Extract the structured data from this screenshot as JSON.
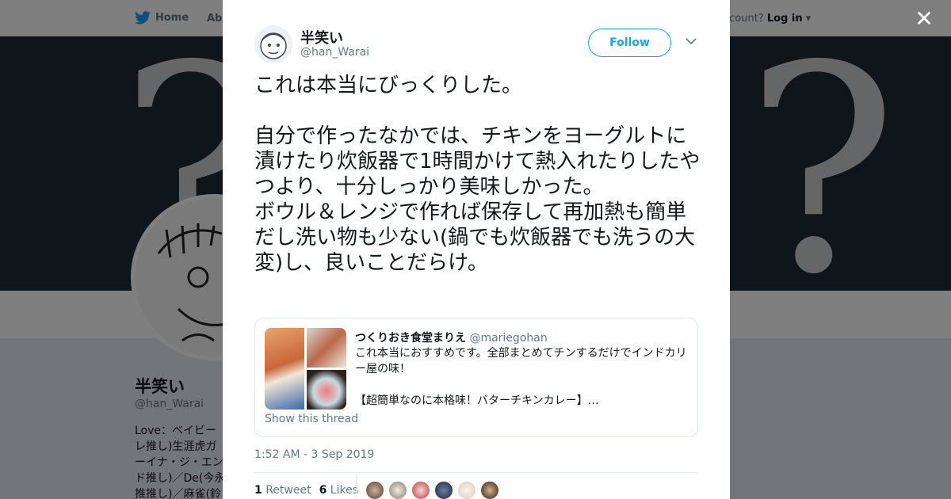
{
  "background": {
    "nav_home": "Home",
    "nav_about": "Abo",
    "account_prompt": "account?",
    "login": "Log in",
    "name": "半笑い",
    "handle": "@han_Warai",
    "bio": "Love：ベイビーレ推し)生涯虎ガーイナ・ジ・エンド推し)／De(今永推推し)／麻雀(鈴木"
  },
  "modal": {
    "user_name": "半笑い",
    "user_handle": "@han_Warai",
    "follow_label": "Follow",
    "tweet_text": "これは本当にびっくりした。\n\n自分で作ったなかでは、チキンをヨーグルトに漬けたり炊飯器で1時間かけて熱入れたりしたやつより、十分しっかり美味しかった。\nボウル＆レンジで作れば保存して再加熱も簡単だし洗い物も少ない(鍋でも炊飯器でも洗うの大変)し、良いことだらけ。",
    "quote": {
      "author_name": "つくりおき食堂まりえ",
      "author_handle": "@mariegohan",
      "text": "これ本当におすすめです。全部まとめてチンするだけでインドカリー屋の味！\n\n【超簡単なのに本格味！バターチキンカレー】…",
      "show_thread": "Show this thread"
    },
    "timestamp": "1:52 AM - 3 Sep 2019",
    "retweet_count": "1",
    "retweet_label": "Retweet",
    "likes_count": "6",
    "likes_label": "Likes"
  },
  "colors": {
    "accent": "#1da1f2",
    "text": "#14171a",
    "muted": "#657786"
  },
  "icons": {
    "close": "close-icon",
    "chevron": "chevron-down-icon",
    "bird": "twitter-bird-icon"
  }
}
